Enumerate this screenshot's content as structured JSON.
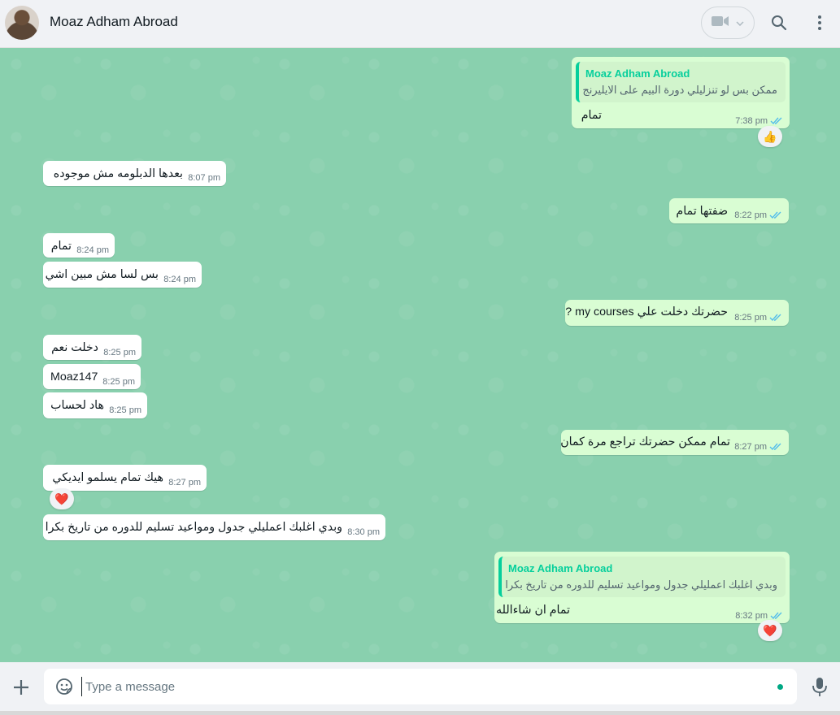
{
  "header": {
    "contact_name": "Moaz Adham Abroad",
    "icons": [
      "avatar",
      "video-call-icon",
      "chevron-down-icon",
      "search-icon",
      "menu-icon"
    ]
  },
  "colors": {
    "chat_bg": "#8fd3b3",
    "outgoing_bubble": "#d9fdd3",
    "incoming_bubble": "#ffffff",
    "read_ticks": "#53bdeb",
    "accent": "#06cf9c"
  },
  "messages": [
    {
      "dir": "out",
      "quote_name": "Moaz Adham Abroad",
      "quote_text": "ممكن بس لو تنزليلي دورة البيم على الايليرنج",
      "text": "تمام",
      "time": "7:38 pm",
      "read": true,
      "reaction": "👍"
    },
    {
      "dir": "in",
      "text": "بعدها الدبلومه مش موجوده",
      "time": "8:07 pm"
    },
    {
      "dir": "out",
      "text": "ضفتها تمام",
      "time": "8:22 pm",
      "read": true
    },
    {
      "dir": "in",
      "text": "تمام",
      "time": "8:24 pm"
    },
    {
      "dir": "in",
      "text": "بس لسا مش مبين اشي",
      "time": "8:24 pm"
    },
    {
      "dir": "out",
      "text": "حضرتك دخلت علي my courses ?",
      "time": "8:25 pm",
      "read": true
    },
    {
      "dir": "in",
      "text": "دخلت نعم",
      "time": "8:25 pm"
    },
    {
      "dir": "in",
      "text": "Moaz147",
      "time": "8:25 pm"
    },
    {
      "dir": "in",
      "text": "هاد لحساب",
      "time": "8:25 pm"
    },
    {
      "dir": "out",
      "text": "تمام ممكن حضرتك تراجع مرة كمان",
      "time": "8:27 pm",
      "read": true
    },
    {
      "dir": "in",
      "text": "هيك تمام يسلمو ايديكي",
      "time": "8:27 pm",
      "reaction": "❤️"
    },
    {
      "dir": "in",
      "text": "وبدي اغلبك اعمليلي جدول ومواعيد تسليم للدوره من تاريخ بكرا",
      "time": "8:30 pm"
    },
    {
      "dir": "out",
      "quote_name": "Moaz Adham Abroad",
      "quote_text": "وبدي اغلبك اعمليلي جدول ومواعيد تسليم للدوره من تاريخ بكرا",
      "text": "تمام ان شاءالله",
      "time": "8:32 pm",
      "read": true,
      "reaction": "❤️"
    }
  ],
  "composer": {
    "placeholder": "Type a message",
    "value": ""
  }
}
